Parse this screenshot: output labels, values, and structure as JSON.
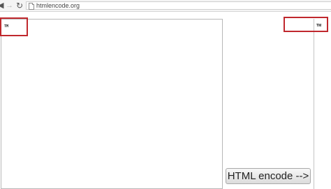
{
  "browser": {
    "url": "htmlencode.org",
    "icons": {
      "back": "back-arrow-icon",
      "forward": "forward-arrow-icon",
      "reload": "reload-icon",
      "page": "page-icon"
    }
  },
  "input": {
    "value": "TM"
  },
  "output": {
    "value": "TM"
  },
  "actions": {
    "encode_label": "HTML encode -->"
  },
  "colors": {
    "highlight": "#c0282d"
  }
}
